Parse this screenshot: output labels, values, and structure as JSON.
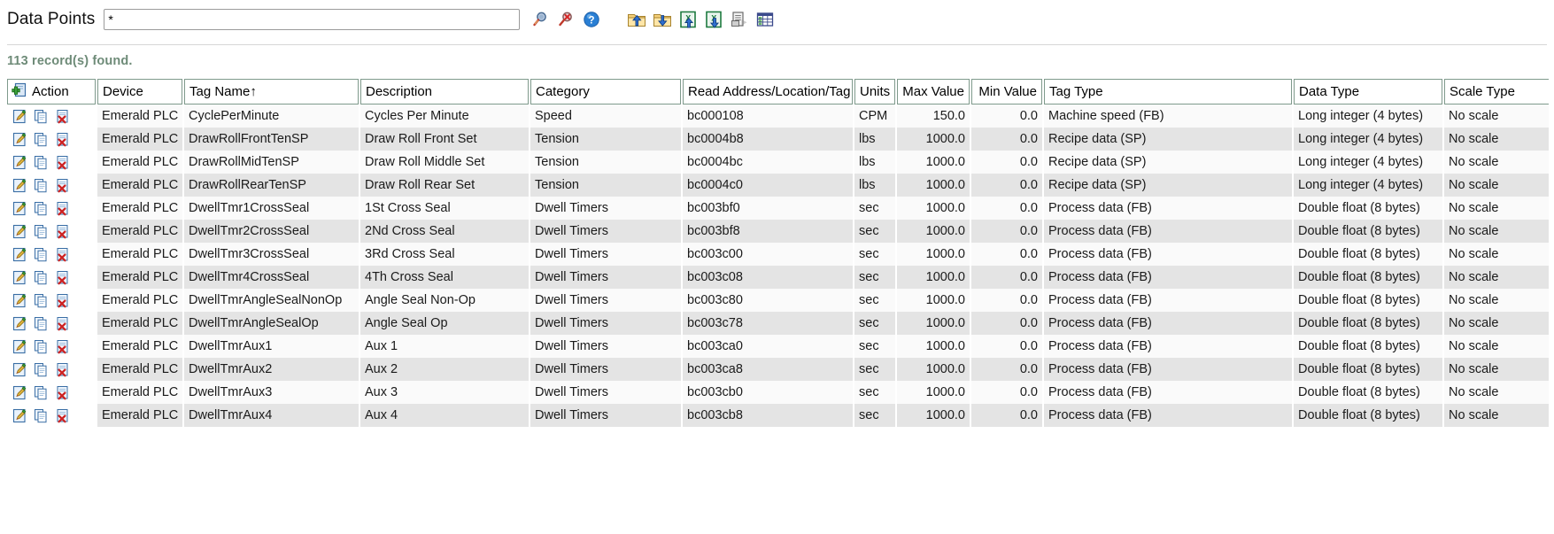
{
  "search": {
    "label": "Data Points",
    "value": "*",
    "placeholder": ""
  },
  "toolbar": {
    "buttons": [
      {
        "name": "search-icon",
        "title": "Search"
      },
      {
        "name": "clear-search-icon",
        "title": "Clear search"
      },
      {
        "name": "help-icon",
        "title": "Help"
      },
      {
        "name": "folder-import-icon",
        "title": "Import"
      },
      {
        "name": "folder-export-icon",
        "title": "Export"
      },
      {
        "name": "excel-import-icon",
        "title": "Import from Excel"
      },
      {
        "name": "excel-export-icon",
        "title": "Export to Excel"
      },
      {
        "name": "print-icon",
        "title": "Print"
      },
      {
        "name": "grid-view-icon",
        "title": "Grid view"
      }
    ]
  },
  "status": {
    "record_count_text": "113 record(s) found."
  },
  "table": {
    "columns": [
      {
        "key": "action",
        "label": "Action",
        "align": "left"
      },
      {
        "key": "device",
        "label": "Device",
        "align": "left"
      },
      {
        "key": "tag",
        "label": "Tag Name↑",
        "align": "left"
      },
      {
        "key": "desc",
        "label": "Description",
        "align": "left"
      },
      {
        "key": "cat",
        "label": "Category",
        "align": "left"
      },
      {
        "key": "addr",
        "label": "Read Address/Location/Tag",
        "align": "left"
      },
      {
        "key": "units",
        "label": "Units",
        "align": "left"
      },
      {
        "key": "max",
        "label": "Max Value",
        "align": "right"
      },
      {
        "key": "min",
        "label": "Min Value",
        "align": "right"
      },
      {
        "key": "tagtype",
        "label": "Tag Type",
        "align": "left"
      },
      {
        "key": "datatype",
        "label": "Data Type",
        "align": "left"
      },
      {
        "key": "scale",
        "label": "Scale Type",
        "align": "left"
      }
    ],
    "sort": {
      "column": "Tag Name",
      "direction": "asc"
    },
    "row_actions": [
      {
        "name": "edit-row-icon",
        "title": "Edit"
      },
      {
        "name": "copy-row-icon",
        "title": "Copy"
      },
      {
        "name": "delete-row-icon",
        "title": "Delete"
      }
    ],
    "rows": [
      {
        "device": "Emerald PLC",
        "tag": "CyclePerMinute",
        "desc": "Cycles Per Minute",
        "cat": "Speed",
        "addr": "bc000108",
        "units": "CPM",
        "max": "150.0",
        "min": "0.0",
        "tagtype": "Machine speed (FB)",
        "datatype": "Long integer (4 bytes)",
        "scale": "No scale"
      },
      {
        "device": "Emerald PLC",
        "tag": "DrawRollFrontTenSP",
        "desc": "Draw Roll Front Set",
        "cat": "Tension",
        "addr": "bc0004b8",
        "units": "lbs",
        "max": "1000.0",
        "min": "0.0",
        "tagtype": "Recipe data (SP)",
        "datatype": "Long integer (4 bytes)",
        "scale": "No scale"
      },
      {
        "device": "Emerald PLC",
        "tag": "DrawRollMidTenSP",
        "desc": "Draw Roll Middle Set",
        "cat": "Tension",
        "addr": "bc0004bc",
        "units": "lbs",
        "max": "1000.0",
        "min": "0.0",
        "tagtype": "Recipe data (SP)",
        "datatype": "Long integer (4 bytes)",
        "scale": "No scale"
      },
      {
        "device": "Emerald PLC",
        "tag": "DrawRollRearTenSP",
        "desc": "Draw Roll Rear Set",
        "cat": "Tension",
        "addr": "bc0004c0",
        "units": "lbs",
        "max": "1000.0",
        "min": "0.0",
        "tagtype": "Recipe data (SP)",
        "datatype": "Long integer (4 bytes)",
        "scale": "No scale"
      },
      {
        "device": "Emerald PLC",
        "tag": "DwellTmr1CrossSeal",
        "desc": "1St Cross Seal",
        "cat": "Dwell Timers",
        "addr": "bc003bf0",
        "units": "sec",
        "max": "1000.0",
        "min": "0.0",
        "tagtype": "Process data (FB)",
        "datatype": "Double float (8 bytes)",
        "scale": "No scale"
      },
      {
        "device": "Emerald PLC",
        "tag": "DwellTmr2CrossSeal",
        "desc": "2Nd Cross Seal",
        "cat": "Dwell Timers",
        "addr": "bc003bf8",
        "units": "sec",
        "max": "1000.0",
        "min": "0.0",
        "tagtype": "Process data (FB)",
        "datatype": "Double float (8 bytes)",
        "scale": "No scale"
      },
      {
        "device": "Emerald PLC",
        "tag": "DwellTmr3CrossSeal",
        "desc": "3Rd Cross Seal",
        "cat": "Dwell Timers",
        "addr": "bc003c00",
        "units": "sec",
        "max": "1000.0",
        "min": "0.0",
        "tagtype": "Process data (FB)",
        "datatype": "Double float (8 bytes)",
        "scale": "No scale"
      },
      {
        "device": "Emerald PLC",
        "tag": "DwellTmr4CrossSeal",
        "desc": "4Th Cross Seal",
        "cat": "Dwell Timers",
        "addr": "bc003c08",
        "units": "sec",
        "max": "1000.0",
        "min": "0.0",
        "tagtype": "Process data (FB)",
        "datatype": "Double float (8 bytes)",
        "scale": "No scale"
      },
      {
        "device": "Emerald PLC",
        "tag": "DwellTmrAngleSealNonOp",
        "desc": "Angle Seal Non-Op",
        "cat": "Dwell Timers",
        "addr": "bc003c80",
        "units": "sec",
        "max": "1000.0",
        "min": "0.0",
        "tagtype": "Process data (FB)",
        "datatype": "Double float (8 bytes)",
        "scale": "No scale"
      },
      {
        "device": "Emerald PLC",
        "tag": "DwellTmrAngleSealOp",
        "desc": "Angle Seal Op",
        "cat": "Dwell Timers",
        "addr": "bc003c78",
        "units": "sec",
        "max": "1000.0",
        "min": "0.0",
        "tagtype": "Process data (FB)",
        "datatype": "Double float (8 bytes)",
        "scale": "No scale"
      },
      {
        "device": "Emerald PLC",
        "tag": "DwellTmrAux1",
        "desc": "Aux 1",
        "cat": "Dwell Timers",
        "addr": "bc003ca0",
        "units": "sec",
        "max": "1000.0",
        "min": "0.0",
        "tagtype": "Process data (FB)",
        "datatype": "Double float (8 bytes)",
        "scale": "No scale"
      },
      {
        "device": "Emerald PLC",
        "tag": "DwellTmrAux2",
        "desc": "Aux 2",
        "cat": "Dwell Timers",
        "addr": "bc003ca8",
        "units": "sec",
        "max": "1000.0",
        "min": "0.0",
        "tagtype": "Process data (FB)",
        "datatype": "Double float (8 bytes)",
        "scale": "No scale"
      },
      {
        "device": "Emerald PLC",
        "tag": "DwellTmrAux3",
        "desc": "Aux 3",
        "cat": "Dwell Timers",
        "addr": "bc003cb0",
        "units": "sec",
        "max": "1000.0",
        "min": "0.0",
        "tagtype": "Process data (FB)",
        "datatype": "Double float (8 bytes)",
        "scale": "No scale"
      },
      {
        "device": "Emerald PLC",
        "tag": "DwellTmrAux4",
        "desc": "Aux 4",
        "cat": "Dwell Timers",
        "addr": "bc003cb8",
        "units": "sec",
        "max": "1000.0",
        "min": "0.0",
        "tagtype": "Process data (FB)",
        "datatype": "Double float (8 bytes)",
        "scale": "No scale"
      }
    ]
  },
  "colors": {
    "status_text": "#6e8b78",
    "header_border": "#7f9a8c",
    "row_odd": "#fafafa",
    "row_even": "#e4e4e4"
  }
}
